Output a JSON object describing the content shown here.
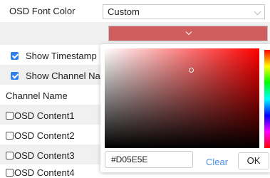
{
  "osd_font_color": {
    "label": "OSD Font Color",
    "value": "Custom",
    "current_color": "#D05E5E",
    "icons": {
      "select_chevron": "chevron-down-icon",
      "trigger_chevron": "chevron-down-icon"
    }
  },
  "settings": [
    {
      "label": "Show Timestamp",
      "checked": true
    },
    {
      "label": "Show Channel Name",
      "checked": true
    },
    {
      "label": "Channel Name"
    },
    {
      "label": "OSD Content1",
      "checked": false
    },
    {
      "label": "OSD Content2",
      "checked": false
    },
    {
      "label": "OSD Content3",
      "checked": false
    },
    {
      "label": "OSD Content4",
      "checked": false
    }
  ],
  "color_picker": {
    "hex_value": "#D05E5E",
    "clear_label": "Clear",
    "ok_label": "OK"
  },
  "colors": {
    "accent": "#2f7fe8",
    "link": "#4a90e2",
    "row_alt": "#f0f0f0"
  }
}
